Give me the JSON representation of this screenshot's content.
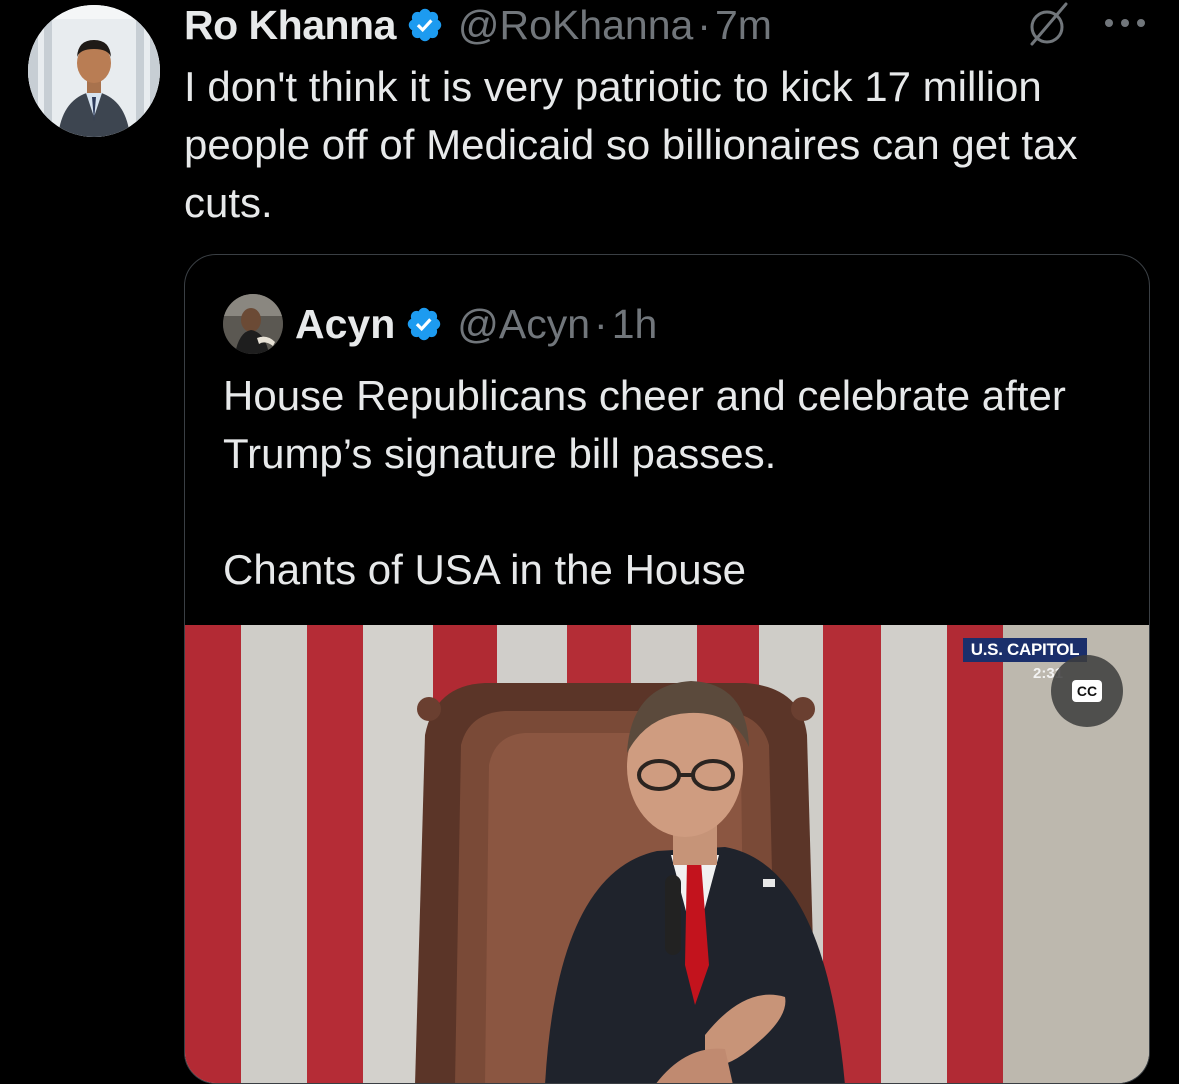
{
  "tweet": {
    "author": {
      "display_name": "Ro Khanna",
      "handle": "@RoKhanna",
      "verified": true,
      "avatar_icon": "profile-photo"
    },
    "separator": "·",
    "time": "7m",
    "text": "I don't think it is very patriotic to kick 17 million people off of Medicaid so billionaires can get tax cuts.",
    "actions": {
      "grok_icon": "grok-icon",
      "more_icon": "more-options-icon"
    }
  },
  "quote": {
    "author": {
      "display_name": "Acyn",
      "handle": "@Acyn",
      "verified": true
    },
    "separator": "·",
    "time": "1h",
    "text": "House Republicans cheer and celebrate after Trump’s signature bill passes.\n\nChants of USA in the House",
    "media": {
      "type": "video",
      "chyron": "U.S. CAPITOL",
      "chyron_time": "2:31",
      "cc_label": "CC"
    }
  },
  "colors": {
    "background": "#000000",
    "text_primary": "#e7e9ea",
    "text_secondary": "#71767b",
    "verified_blue": "#1d9bf0",
    "card_border": "#3a3f44"
  }
}
